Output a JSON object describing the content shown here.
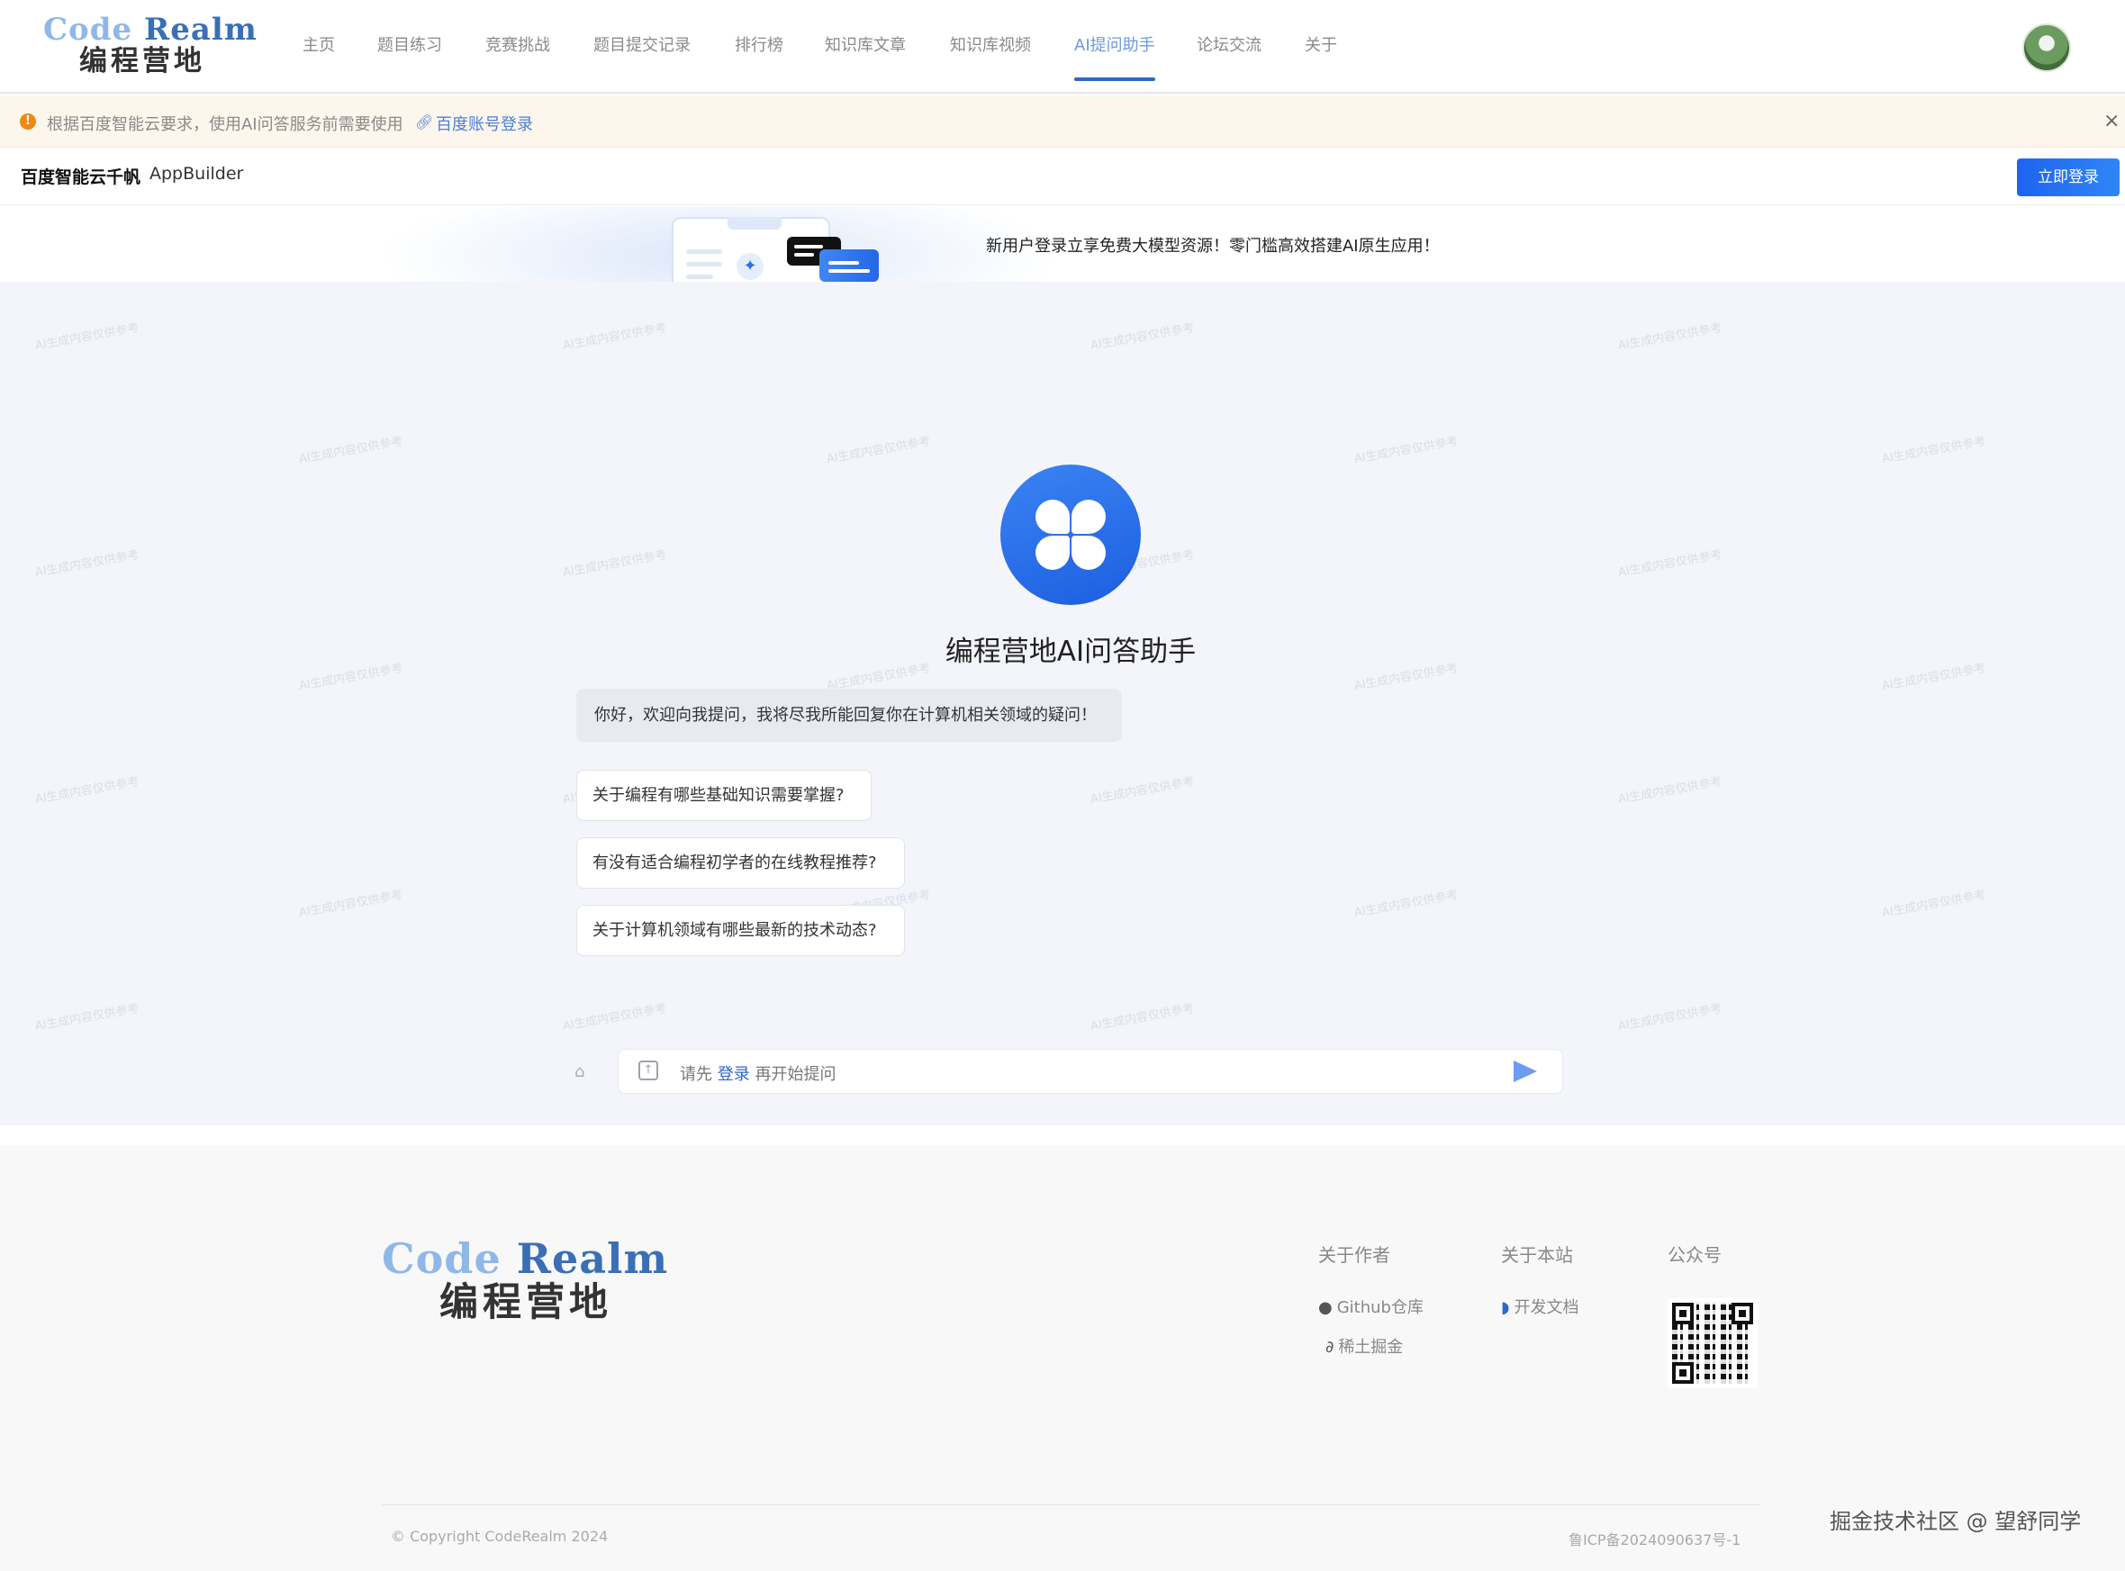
{
  "header": {
    "logo_en_part1": "Code",
    "logo_en_part2": " Realm",
    "logo_cn": "编程营地",
    "nav": [
      {
        "label": "主页",
        "active": false
      },
      {
        "label": "题目练习",
        "active": false
      },
      {
        "label": "竞赛挑战",
        "active": false
      },
      {
        "label": "题目提交记录",
        "active": false
      },
      {
        "label": "排行榜",
        "active": false
      },
      {
        "label": "知识库文章",
        "active": false
      },
      {
        "label": "知识库视频",
        "active": false
      },
      {
        "label": "AI提问助手",
        "active": true
      },
      {
        "label": "论坛交流",
        "active": false
      },
      {
        "label": "关于",
        "active": false
      }
    ],
    "avatar_icon": "user-avatar"
  },
  "notice": {
    "icon": "warning-icon",
    "text": "根据百度智能云要求，使用AI问答服务前需要使用",
    "link_label": "百度账号登录",
    "close_glyph": "×"
  },
  "appbar": {
    "brand_cn": "百度智能云千帆",
    "brand_en": "AppBuilder",
    "login_label": "立即登录"
  },
  "promo": {
    "text": "新用户登录立享免费大模型资源！零门槛高效搭建AI原生应用！"
  },
  "chat": {
    "watermark": "AI生成内容仅供参考",
    "title": "编程营地AI问答助手",
    "welcome": "你好，欢迎向我提问，我将尽我所能回复你在计算机相关领域的疑问！",
    "suggestions": [
      "关于编程有哪些基础知识需要掌握?",
      "有没有适合编程初学者的在线教程推荐?",
      "关于计算机领域有哪些最新的技术动态?"
    ],
    "input_prefix": "请先",
    "input_login": "登录",
    "input_suffix": "再开始提问"
  },
  "footer": {
    "logo_en_part1": "Code",
    "logo_en_part2": " Realm",
    "logo_cn": "编程营地",
    "col_author": "关于作者",
    "col_site": "关于本站",
    "col_wechat": "公众号",
    "link_github": "Github仓库",
    "link_juejin": "稀土掘金",
    "link_docs": "开发文档",
    "copyright": "© Copyright CodeRealm 2024",
    "icp": "鲁ICP备2024090637号-1",
    "credit": "掘金技术社区 @ 望舒同学"
  },
  "colors": {
    "accent": "#2d67c9",
    "nav_active": "#6e9ad8",
    "notice_bg": "#fdf6ec",
    "login_btn": "#1e63f0",
    "chat_bg": "#f3f5fa"
  }
}
